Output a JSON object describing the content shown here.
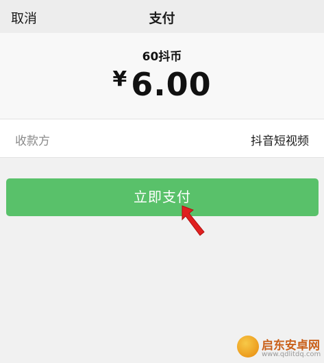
{
  "navbar": {
    "cancel_label": "取消",
    "title": "支付"
  },
  "order": {
    "product": "60抖币",
    "currency_symbol": "¥",
    "amount": "6.00"
  },
  "payee": {
    "label": "收款方",
    "name": "抖音短视频"
  },
  "actions": {
    "pay_label": "立即支付"
  },
  "annotation": {
    "arrow_icon": "red-arrow-icon",
    "color": "#e02020"
  },
  "watermark": {
    "brand": "启东安卓网",
    "url": "www.qdlitdq.com",
    "icon": "watermark-logo-icon"
  },
  "colors": {
    "primary_button": "#59c16a",
    "background": "#f1f1f1",
    "navbar": "#ededed"
  }
}
